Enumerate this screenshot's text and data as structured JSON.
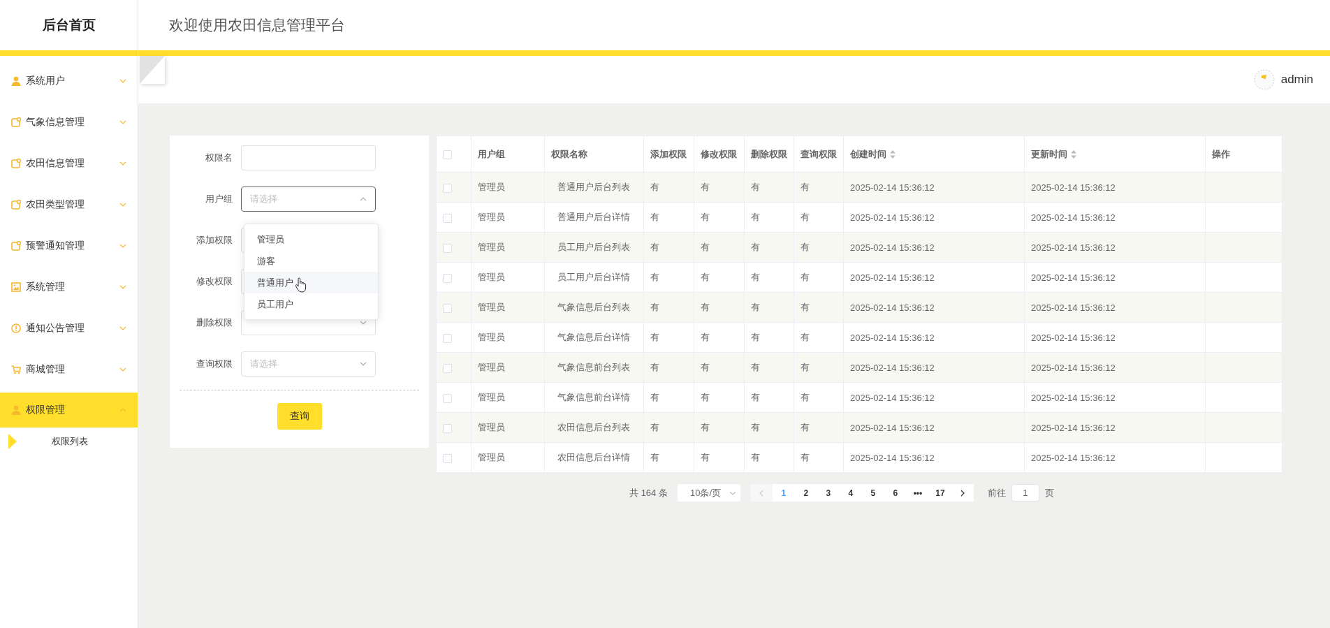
{
  "sidebar": {
    "title": "后台首页",
    "items": [
      {
        "label": "系统用户",
        "kind": "user",
        "expanded": false,
        "selected": false
      },
      {
        "label": "气象信息管理",
        "kind": "note",
        "expanded": false,
        "selected": false
      },
      {
        "label": "农田信息管理",
        "kind": "note",
        "expanded": false,
        "selected": false
      },
      {
        "label": "农田类型管理",
        "kind": "note",
        "expanded": false,
        "selected": false
      },
      {
        "label": "预警通知管理",
        "kind": "note",
        "expanded": false,
        "selected": false
      },
      {
        "label": "系统管理",
        "kind": "image",
        "expanded": false,
        "selected": false
      },
      {
        "label": "通知公告管理",
        "kind": "info",
        "expanded": false,
        "selected": false
      },
      {
        "label": "商城管理",
        "kind": "cart",
        "expanded": false,
        "selected": false
      },
      {
        "label": "权限管理",
        "kind": "user",
        "expanded": true,
        "selected": true,
        "children": [
          {
            "label": "权限列表",
            "selected": true
          }
        ]
      }
    ]
  },
  "header": {
    "title": "欢迎使用农田信息管理平台",
    "user": "admin"
  },
  "form": {
    "fields": [
      {
        "label": "权限名",
        "kind": "text"
      },
      {
        "label": "用户组",
        "kind": "select",
        "placeholder": "请选择",
        "open": true,
        "options": [
          {
            "label": "管理员",
            "hovered": false
          },
          {
            "label": "游客",
            "hovered": false
          },
          {
            "label": "普通用户",
            "hovered": true
          },
          {
            "label": "员工用户",
            "hovered": false
          }
        ]
      },
      {
        "label": "添加权限",
        "kind": "select",
        "covered": true
      },
      {
        "label": "修改权限",
        "kind": "select",
        "covered": true
      },
      {
        "label": "删除权限",
        "kind": "select"
      },
      {
        "label": "查询权限",
        "kind": "select",
        "placeholder": "请选择"
      }
    ],
    "button": "查询"
  },
  "table": {
    "select_all": {
      "checked": false
    },
    "columns": [
      {
        "label": "用户组",
        "kind": "text"
      },
      {
        "label": "权限名称",
        "kind": "name"
      },
      {
        "label": "添加权限",
        "kind": "text"
      },
      {
        "label": "修改权限",
        "kind": "text"
      },
      {
        "label": "删除权限",
        "kind": "text"
      },
      {
        "label": "查询权限",
        "kind": "text"
      },
      {
        "label": "创建时间",
        "kind": "sort"
      },
      {
        "label": "更新时间",
        "kind": "sort"
      },
      {
        "label": "操作",
        "kind": "text"
      }
    ],
    "rows": [
      {
        "checked": false,
        "cells": [
          "管理员",
          "普通用户后台列表",
          "有",
          "有",
          "有",
          "有",
          "2025-02-14 15:36:12",
          "2025-02-14 15:36:12"
        ]
      },
      {
        "checked": false,
        "cells": [
          "管理员",
          "普通用户后台详情",
          "有",
          "有",
          "有",
          "有",
          "2025-02-14 15:36:12",
          "2025-02-14 15:36:12"
        ]
      },
      {
        "checked": false,
        "cells": [
          "管理员",
          "员工用户后台列表",
          "有",
          "有",
          "有",
          "有",
          "2025-02-14 15:36:12",
          "2025-02-14 15:36:12"
        ]
      },
      {
        "checked": false,
        "cells": [
          "管理员",
          "员工用户后台详情",
          "有",
          "有",
          "有",
          "有",
          "2025-02-14 15:36:12",
          "2025-02-14 15:36:12"
        ]
      },
      {
        "checked": false,
        "cells": [
          "管理员",
          "气象信息后台列表",
          "有",
          "有",
          "有",
          "有",
          "2025-02-14 15:36:12",
          "2025-02-14 15:36:12"
        ]
      },
      {
        "checked": false,
        "cells": [
          "管理员",
          "气象信息后台详情",
          "有",
          "有",
          "有",
          "有",
          "2025-02-14 15:36:12",
          "2025-02-14 15:36:12"
        ]
      },
      {
        "checked": false,
        "cells": [
          "管理员",
          "气象信息前台列表",
          "有",
          "有",
          "有",
          "有",
          "2025-02-14 15:36:12",
          "2025-02-14 15:36:12"
        ]
      },
      {
        "checked": false,
        "cells": [
          "管理员",
          "气象信息前台详情",
          "有",
          "有",
          "有",
          "有",
          "2025-02-14 15:36:12",
          "2025-02-14 15:36:12"
        ]
      },
      {
        "checked": false,
        "cells": [
          "管理员",
          "农田信息后台列表",
          "有",
          "有",
          "有",
          "有",
          "2025-02-14 15:36:12",
          "2025-02-14 15:36:12"
        ]
      },
      {
        "checked": false,
        "cells": [
          "管理员",
          "农田信息后台详情",
          "有",
          "有",
          "有",
          "有",
          "2025-02-14 15:36:12",
          "2025-02-14 15:36:12"
        ]
      }
    ]
  },
  "pagination": {
    "total": "共 164 条",
    "page_size": "10条/页",
    "prev_disabled": true,
    "pages": [
      {
        "label": "1",
        "selected": true
      },
      {
        "label": "2",
        "selected": false
      },
      {
        "label": "3",
        "selected": false
      },
      {
        "label": "4",
        "selected": false
      },
      {
        "label": "5",
        "selected": false
      },
      {
        "label": "6",
        "selected": false
      },
      {
        "label": "•••",
        "selected": false
      },
      {
        "label": "17",
        "selected": false
      }
    ],
    "goto_label": "前往",
    "goto_value": "1",
    "goto_suffix": "页"
  }
}
